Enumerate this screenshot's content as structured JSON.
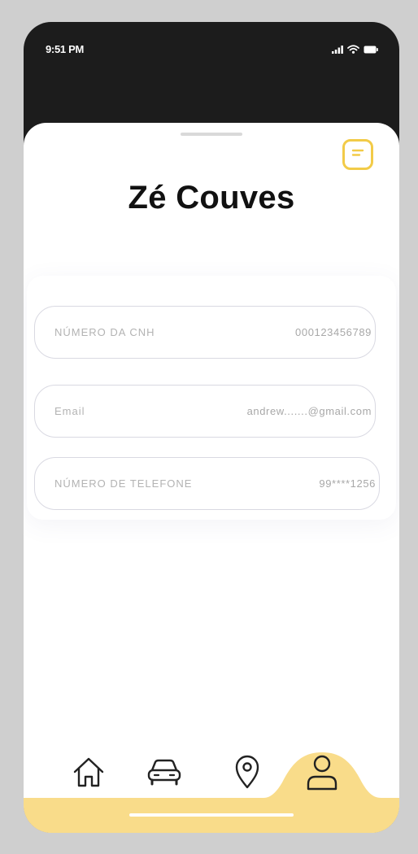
{
  "status_bar": {
    "time": "9:51 PM",
    "icons": [
      "cellular-signal-icon",
      "wifi-icon",
      "battery-icon"
    ]
  },
  "header": {
    "note_icon": "note-icon",
    "accent_color": "#f2cb48"
  },
  "profile": {
    "name": "Zé Couves"
  },
  "fields": [
    {
      "label": "NÚMERO DA CNH",
      "value": "000123456789"
    },
    {
      "label": "Email",
      "value": "andrew.......@gmail.com"
    },
    {
      "label": "NÚMERO DE TELEFONE",
      "value": "99****1256"
    }
  ],
  "bottom_nav": {
    "items": [
      {
        "icon": "home-icon",
        "active": false
      },
      {
        "icon": "car-icon",
        "active": false
      },
      {
        "icon": "location-pin-icon",
        "active": false
      },
      {
        "icon": "user-icon",
        "active": true
      }
    ],
    "active_color": "#f9dc8a"
  }
}
